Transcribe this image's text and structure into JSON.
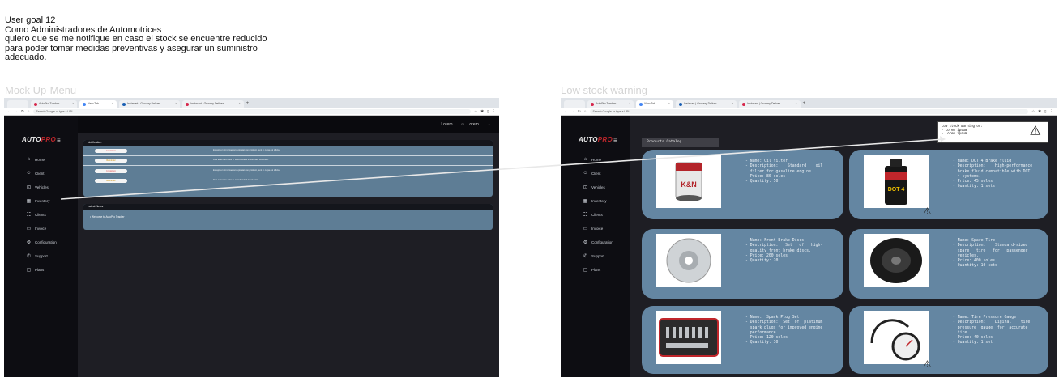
{
  "goal": {
    "text": "User goal 12\nComo Administradores de Automotrices\nquiero que se me notifique en caso el stock se encuentre reducido\npara poder tomar medidas preventivas y asegurar un suministro\nadecuado."
  },
  "frames": {
    "left_label": "Mock Up-Menu",
    "right_label": "Low stock warning"
  },
  "browser": {
    "tabs": [
      "AutoPro Tracker",
      "New Tab",
      "Instacart | Grocery Deliver...",
      "Instacart | Grocery Deliver..."
    ],
    "tab_colors": [
      "#d6264b",
      "#4285f4",
      "#1a5fb4",
      "#d6264b"
    ],
    "address": "Search Google or type a URL",
    "nav_icons": [
      "back-arrow",
      "forward-arrow",
      "reload",
      "home"
    ],
    "plus": "+"
  },
  "brand": {
    "logo_a": "AUTO",
    "logo_b": "PRO"
  },
  "nav": [
    {
      "icon": "⌂",
      "label": "Home"
    },
    {
      "icon": "☺",
      "label": "Client"
    },
    {
      "icon": "⊡",
      "label": "Vehicles"
    },
    {
      "icon": "▦",
      "label": "Inventory"
    },
    {
      "icon": "☷",
      "label": "Clients"
    },
    {
      "icon": "▭",
      "label": "Invoice"
    },
    {
      "icon": "⚙",
      "label": "Configuration"
    },
    {
      "icon": "✆",
      "label": "Support"
    },
    {
      "icon": "▢",
      "label": "Plans"
    }
  ],
  "topbar": {
    "lorem": "Lorem",
    "user": "Lorem",
    "chevron": "⌄",
    "user_icon": "☺"
  },
  "notifications": {
    "title": "Notification",
    "rows": [
      {
        "badge": "Important",
        "type": "important",
        "text": "Excepteur sint occaecat cupidatat non proident, sunt in culpa qui officia."
      },
      {
        "badge": "Reminder",
        "type": "reminder",
        "text": "Duis aute irure dolor in reprehenderit in voluptate velit esse."
      },
      {
        "badge": "Important",
        "type": "important",
        "text": "Excepteur sint occaecat cupidatat non proident, sunt in culpa qui officia."
      },
      {
        "badge": "Reminder",
        "type": "reminder",
        "text": "Duis aute irure dolor in reprehenderit in voluptate."
      }
    ]
  },
  "news": {
    "title": "Latest News",
    "item": "• Welcome to AutoPro Tracker"
  },
  "catalog": {
    "title": "Products Catalog"
  },
  "products": [
    {
      "name": "Oil filter",
      "text": "- Name: Oil filter\n- Description:    Standard    oil\n  filter for gasoline engine\n- Price: 80 soles\n- Quantity: 50",
      "image": "oil-filter",
      "low_stock": false
    },
    {
      "name": "DOT 4 Brake fluid",
      "text": "- Name: DOT 4 Brake fluid\n- Description:    High-performance\n  brake fluid compatible with DOT\n  4 systems.\n- Price: 45 soles\n- Quantity: 1 sets",
      "image": "brake-fluid",
      "low_stock": true
    },
    {
      "name": "Front Brake Discs",
      "text": "- Name: Front Brake Discs\n- Description:   Set   of   high-\n  quality front brake discs.\n- Price: 200 soles\n- Quantity: 20",
      "image": "brake-disc",
      "low_stock": false
    },
    {
      "name": "Spare Tire",
      "text": "- Name: Spare Tire\n- Description:    Standard-sized\n  spare   tire   for   passenger\n  vehicles.\n- Price: 400 soles\n- Quantity: 10 sets",
      "image": "spare-tire",
      "low_stock": false
    },
    {
      "name": "Spark Plug Set",
      "text": "- Name:  Spark Plug Set\n- Description:  Set  of  platinum\n  spark plugs for improved engine\n  performance\n- Price: 120 soles\n- Quantity: 30",
      "image": "spark-plug-set",
      "low_stock": false
    },
    {
      "name": "Tire Pressure Gauge",
      "text": "- Name: Tire Pressure Gauge\n- Description:    Digital    tire\n  pressure  gauge  for  accurate\n  tire\n- Price: 40 soles\n- Quantity: 1 set",
      "image": "tire-gauge",
      "low_stock": true
    }
  ],
  "alert": {
    "text": "Low stock warning on:\n- Lorem ipsum\n- Lorem ipsum",
    "icon": "⚠"
  },
  "warn_icon": "⚠",
  "colors": {
    "accent": "#c0262b",
    "card": "#6486a2",
    "panel": "#5e7d95",
    "dark": "#1e1e24"
  }
}
